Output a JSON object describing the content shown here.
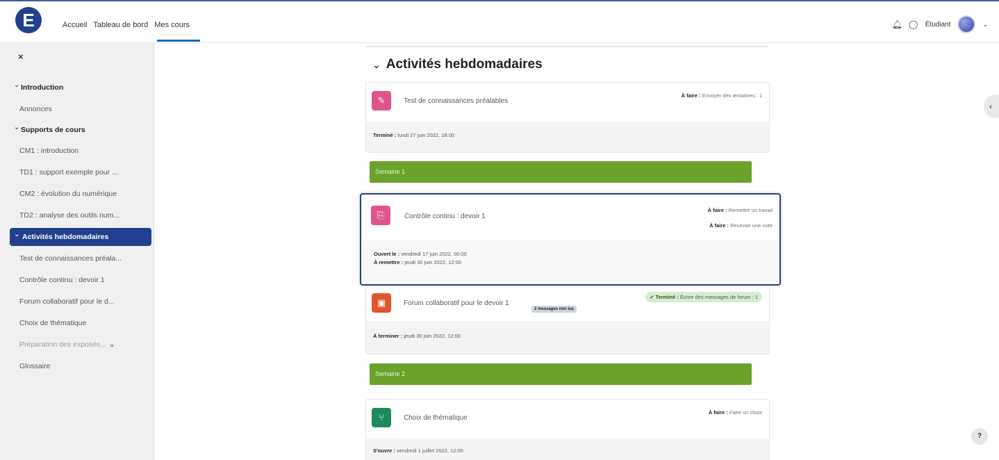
{
  "header": {
    "logo_letter": "E",
    "nav": [
      "Accueil",
      "Tableau de bord",
      "Mes cours"
    ],
    "user_label": "Étudiant"
  },
  "sidebar": {
    "close_symbol": "×",
    "items": [
      {
        "label": "Introduction",
        "type": "section"
      },
      {
        "label": "Annonces",
        "type": "item"
      },
      {
        "label": "Supports de cours",
        "type": "section"
      },
      {
        "label": "CM1 : introduction",
        "type": "item"
      },
      {
        "label": "TD1 : support exemple pour ...",
        "type": "item"
      },
      {
        "label": "CM2 : évolution du numérique",
        "type": "item"
      },
      {
        "label": "TD2 : analyse des outils num...",
        "type": "item"
      },
      {
        "label": "Activités hebdomadaires",
        "type": "active"
      },
      {
        "label": "Test de connaissances préala...",
        "type": "item"
      },
      {
        "label": "Contrôle continu : devoir 1",
        "type": "item"
      },
      {
        "label": "Forum collaboratif pour le d...",
        "type": "item"
      },
      {
        "label": "Choix de thématique",
        "type": "item"
      },
      {
        "label": "Préparation des exposés...",
        "type": "dim"
      },
      {
        "label": "Glossaire",
        "type": "item"
      }
    ]
  },
  "main": {
    "section_title": "Activités hebdomadaires",
    "activities": {
      "test": {
        "title": "Test de connaissances préalables",
        "todo_label": "À faire :",
        "todo_text": "Envoyer des tentatives : 1",
        "foot_label": "Terminé :",
        "foot_text": "lundi 27 juin 2022, 18:00",
        "color": "#e0548c"
      },
      "devoir": {
        "title": "Contrôle continu : devoir 1",
        "todo1_label": "À faire :",
        "todo1_text": "Remettre un travail",
        "todo2_label": "À faire :",
        "todo2_text": "Recevoir une note",
        "open_label": "Ouvert le :",
        "open_text": "vendredi 17 juin 2022, 00:00",
        "due_label": "À remettre :",
        "due_text": "jeudi 30 juin 2022, 12:00",
        "color": "#e0548c"
      },
      "forum": {
        "title": "Forum collaboratif pour le devoir 1",
        "badge": "2 messages non lus",
        "done_label": "✔ Terminé :",
        "done_text": "Écrire des messages de forum : 1",
        "foot_label": "À terminer :",
        "foot_text": "jeudi 30 juin 2022, 12:00",
        "color": "#e0562f"
      },
      "choix": {
        "title": "Choix de thématique",
        "todo_label": "À faire :",
        "todo_text": "Faire un choix",
        "open_label": "S'ouvre :",
        "open_text": "vendredi 1 juillet 2022, 12:00",
        "color": "#1f8a5c"
      }
    },
    "weeks": [
      "Semaine 1",
      "Semaine 2"
    ],
    "week_color": "#6aa22b",
    "help_label": "?"
  },
  "colors": {
    "primary": "#23408e",
    "accent": "#0f6cbf"
  }
}
